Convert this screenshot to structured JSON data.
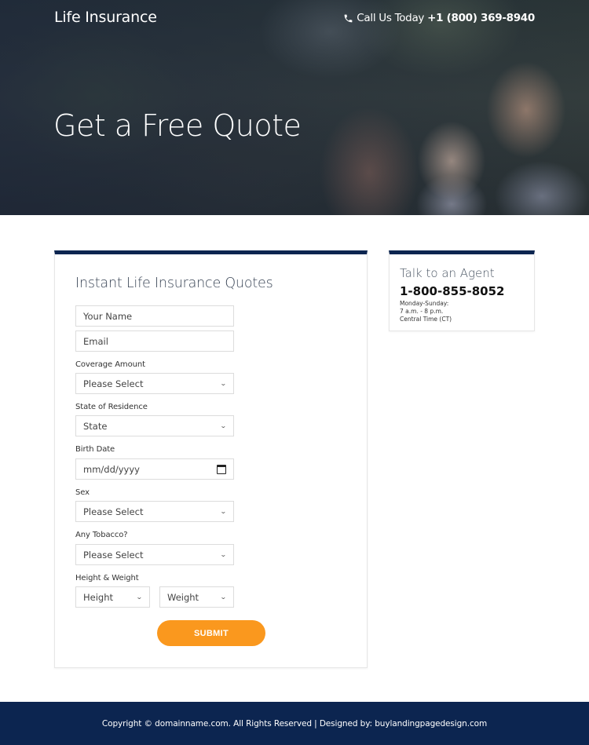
{
  "header": {
    "brand": "Life Insurance",
    "call_label": "Call Us Today",
    "call_number": "+1 (800) 369-8940",
    "phone_icon": "phone-icon"
  },
  "hero": {
    "title": "Get a Free Quote"
  },
  "form": {
    "title": "Instant Life Insurance Quotes",
    "name_placeholder": "Your Name",
    "email_placeholder": "Email",
    "coverage_label": "Coverage Amount",
    "coverage_value": "Please Select",
    "state_label": "State of Residence",
    "state_value": "State",
    "birth_label": "Birth Date",
    "birth_placeholder": "mm/dd/yyyy",
    "sex_label": "Sex",
    "sex_value": "Please Select",
    "tobacco_label": "Any Tobacco?",
    "tobacco_value": "Please Select",
    "hw_label": "Height & Weight",
    "height_value": "Height",
    "weight_value": "Weight",
    "submit_label": "SUBMIT",
    "chevron": "⌄"
  },
  "agent": {
    "title": "Talk to an Agent",
    "phone": "1-800-855-8052",
    "hours_days": "Monday-Sunday:",
    "hours_time": "7 a.m. - 8 p.m.",
    "hours_zone": "Central Time (CT)"
  },
  "footer": {
    "text": "Copyright © domainname.com. All Rights Reserved | Designed by: buylandingpagedesign.com"
  },
  "colors": {
    "navy": "#0c2550",
    "accent_orange": "#fa981e"
  }
}
